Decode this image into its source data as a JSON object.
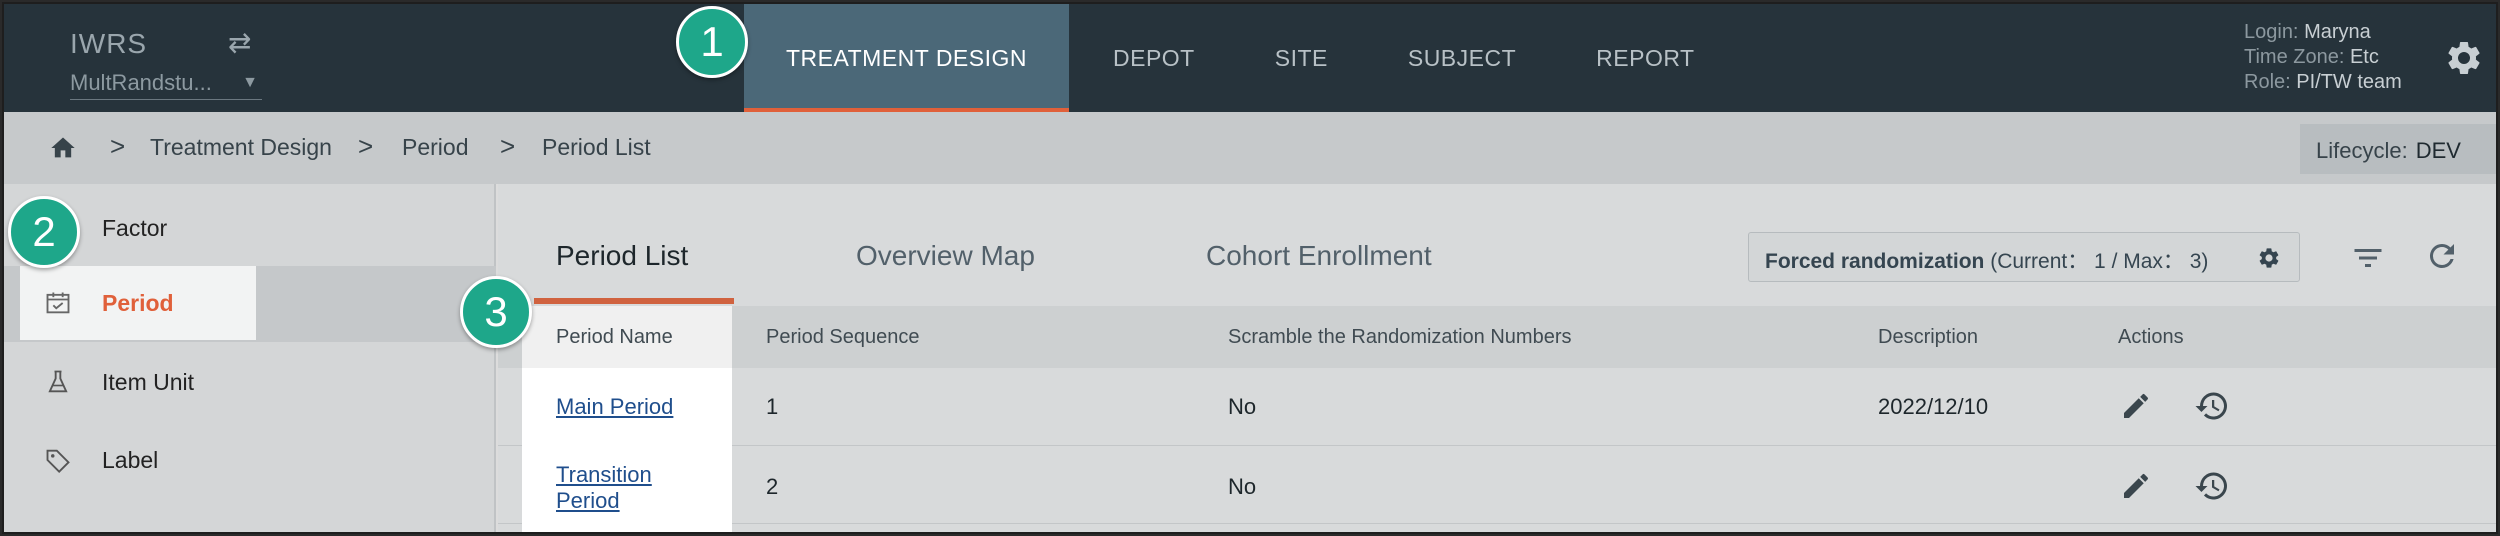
{
  "app": {
    "brand": "IWRS",
    "study": "MultRandstu...",
    "nav_tabs": [
      {
        "label": "TREATMENT DESIGN",
        "active": true
      },
      {
        "label": "DEPOT",
        "active": false
      },
      {
        "label": "SITE",
        "active": false
      },
      {
        "label": "SUBJECT",
        "active": false
      },
      {
        "label": "REPORT",
        "active": false
      }
    ],
    "user": {
      "login_label": "Login:",
      "login_value": "Maryna",
      "timezone_label": "Time Zone:",
      "timezone_value": "Etc",
      "role_label": "Role:",
      "role_value": "PI/TW team"
    }
  },
  "breadcrumb": {
    "items": [
      "Treatment Design",
      "Period",
      "Period List"
    ],
    "separator": ">"
  },
  "lifecycle": {
    "label": "Lifecycle:",
    "value": "DEV"
  },
  "sidebar": {
    "items": [
      {
        "label": "Factor",
        "icon": "factor-icon"
      },
      {
        "label": "Period",
        "icon": "calendar-icon",
        "active": true
      },
      {
        "label": "Item Unit",
        "icon": "flask-icon"
      },
      {
        "label": "Label",
        "icon": "tag-icon"
      }
    ]
  },
  "content": {
    "tabs": [
      {
        "label": "Period List",
        "active": true
      },
      {
        "label": "Overview Map",
        "active": false
      },
      {
        "label": "Cohort Enrollment",
        "active": false
      }
    ],
    "forced": {
      "title": "Forced randomization",
      "detail": "(Current： 1 / Max： 3)"
    },
    "table": {
      "headers": [
        "Period Name",
        "Period Sequence",
        "Scramble the Randomization Numbers",
        "Description",
        "Actions"
      ],
      "rows": [
        {
          "name": "Main Period",
          "sequence": "1",
          "scramble": "No",
          "description": "2022/12/10"
        },
        {
          "name_line1": "Transition",
          "name_line2": "Period",
          "sequence": "2",
          "scramble": "No",
          "description": ""
        }
      ]
    }
  },
  "callouts": [
    "1",
    "2",
    "3"
  ],
  "colors": {
    "nav_bg": "#26333b",
    "active_tab_bg": "#4b6878",
    "accent": "#e0603a",
    "badge": "#1ea78a",
    "link": "#1f4e8c"
  }
}
